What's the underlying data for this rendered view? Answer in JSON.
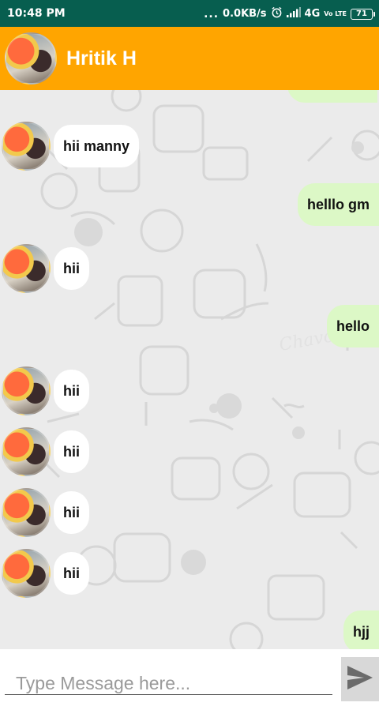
{
  "status_bar": {
    "time": "10:48 PM",
    "dots": "...",
    "speed": "0.0KB/s",
    "network": "4G",
    "volte": "Vo LTE",
    "battery": "71"
  },
  "header": {
    "contact_name": "Hritik H"
  },
  "messages": [
    {
      "from": "them",
      "text": "hii manny"
    },
    {
      "from": "me",
      "text": "helllo gm"
    },
    {
      "from": "them",
      "text": "hii"
    },
    {
      "from": "me",
      "text": "hello"
    },
    {
      "from": "them",
      "text": "hii"
    },
    {
      "from": "them",
      "text": "hii"
    },
    {
      "from": "them",
      "text": "hii"
    },
    {
      "from": "them",
      "text": "hii"
    },
    {
      "from": "me",
      "text": "hjj"
    }
  ],
  "watermark": "Chavo Chillo",
  "composer": {
    "placeholder": "Type Message here..."
  },
  "colors": {
    "status_bar": "#075e4f",
    "app_bar": "#ffa500",
    "outgoing_bubble": "#dcf8c6",
    "incoming_bubble": "#ffffff"
  },
  "icons": {
    "send": "send-icon",
    "alarm": "alarm-icon",
    "signal": "signal-icon"
  }
}
